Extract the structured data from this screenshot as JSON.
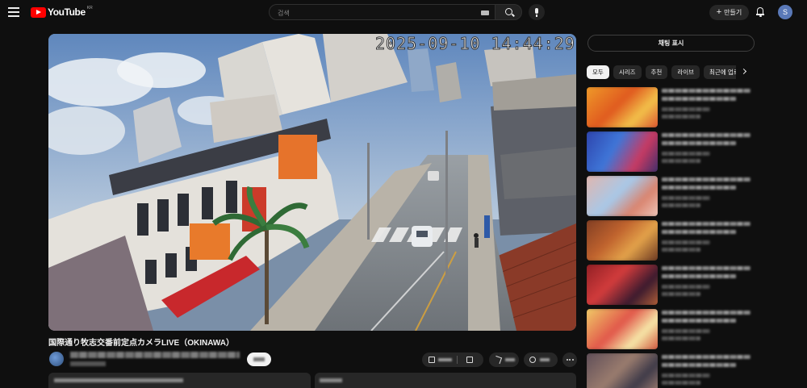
{
  "header": {
    "logo_text": "YouTube",
    "logo_country": "KR",
    "search_placeholder": "검색",
    "create_label": "만들기",
    "avatar_initial": "S"
  },
  "player": {
    "timestamp": "2025-09-10 14:44:29"
  },
  "video": {
    "title": "国際通り牧志交番前定点カメラLIVE（OKINAWA）"
  },
  "sidebar": {
    "chat_toggle_label": "채팅 표시",
    "chips": [
      "모두",
      "시리즈",
      "추천",
      "라이브",
      "최근에 업로드된 동영상"
    ]
  },
  "colors": {
    "background": "#0f0f0f",
    "brand_red": "#ff0000",
    "surface": "#272727"
  }
}
